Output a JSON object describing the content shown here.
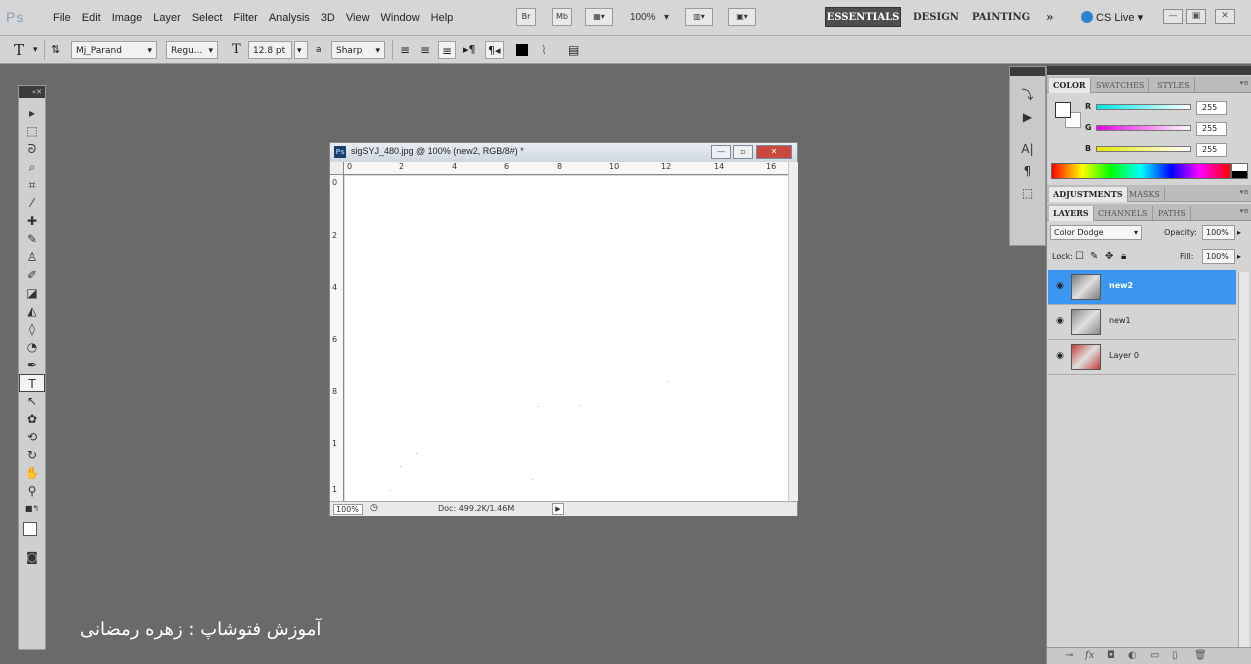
{
  "app": {
    "logo": "Ps"
  },
  "menu": [
    "File",
    "Edit",
    "Image",
    "Layer",
    "Select",
    "Filter",
    "Analysis",
    "3D",
    "View",
    "Window",
    "Help"
  ],
  "menubar": {
    "br_label": "Br",
    "mb_label": "Mb",
    "zoom": "100%",
    "workspaces": [
      "ESSENTIALS",
      "DESIGN",
      "PAINTING"
    ],
    "more": "»",
    "cslive": "CS Live"
  },
  "options": {
    "tool_icon": "T",
    "font_family": "Mj_Parand",
    "font_style": "Regu...",
    "font_size": "12.8 pt",
    "aa_label": "a",
    "antialias": "Sharp"
  },
  "document": {
    "title": "sigSYJ_480.jpg @ 100% (new2, RGB/8#) *",
    "zoom": "100%",
    "doc_info": "Doc: 499.2K/1.46M",
    "ruler_h": [
      "0",
      "2",
      "4",
      "6",
      "8",
      "10",
      "12",
      "14",
      "16"
    ],
    "ruler_v": [
      "0",
      "2",
      "4",
      "6",
      "8",
      "1",
      "1"
    ]
  },
  "color_panel": {
    "tabs": [
      "COLOR",
      "SWATCHES",
      "STYLES"
    ],
    "channels": [
      {
        "name": "R",
        "value": "255",
        "gradient": "#00e6e6"
      },
      {
        "name": "G",
        "value": "255",
        "gradient": "#e600e6"
      },
      {
        "name": "B",
        "value": "255",
        "gradient": "#e6e600"
      }
    ]
  },
  "adjustments_panel": {
    "tabs": [
      "ADJUSTMENTS",
      "MASKS"
    ]
  },
  "layers_panel": {
    "tabs": [
      "LAYERS",
      "CHANNELS",
      "PATHS"
    ],
    "blend_mode": "Color Dodge",
    "opacity_label": "Opacity:",
    "opacity": "100%",
    "lock_label": "Lock:",
    "fill_label": "Fill:",
    "fill": "100%",
    "layers": [
      {
        "name": "new2",
        "selected": true,
        "thumb": "#7a7a7a"
      },
      {
        "name": "new1",
        "selected": false,
        "thumb": "#8a8a8a"
      },
      {
        "name": "Layer 0",
        "selected": false,
        "thumb": "#c0403a"
      }
    ]
  },
  "caption": "آموزش فتوشاپ : زهره رمضانی"
}
